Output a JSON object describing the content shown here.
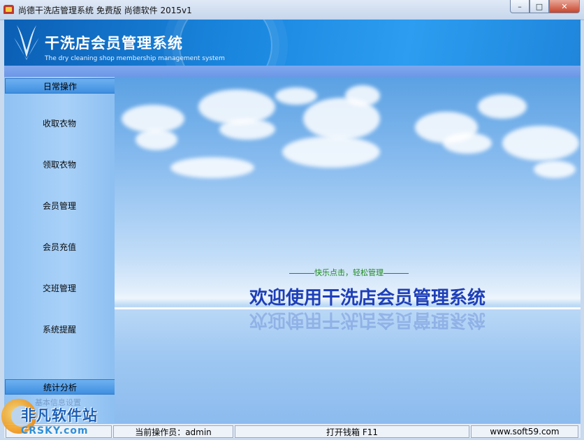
{
  "window": {
    "title": "尚德干洗店管理系统 免费版 尚德软件 2015v1",
    "controls": {
      "minimize": "–",
      "maximize": "□",
      "close": "✕"
    }
  },
  "banner": {
    "title": "干洗店会员管理系统",
    "subtitle": "The dry cleaning shop membership management system"
  },
  "sidebar": {
    "daily_header": "日常操作",
    "items": [
      "收取衣物",
      "领取衣物",
      "会员管理",
      "会员充值",
      "交班管理",
      "系统提醒"
    ],
    "stats_header": "统计分析",
    "ghost_item": "基本信息设置"
  },
  "main": {
    "slogan": "快乐点击，轻松管理",
    "welcome": "欢迎使用干洗店会员管理系统"
  },
  "statusbar": {
    "operator": "当前操作员：admin",
    "cash_drawer": "打开钱箱 F11",
    "website": "www.soft59.com"
  },
  "watermark": {
    "name": "非凡软件站",
    "domain": "CRSKY.com"
  },
  "colors": {
    "banner_blue": "#1a86de",
    "welcome_text": "#1e3fb8",
    "slogan_green": "#1f8a1f"
  }
}
